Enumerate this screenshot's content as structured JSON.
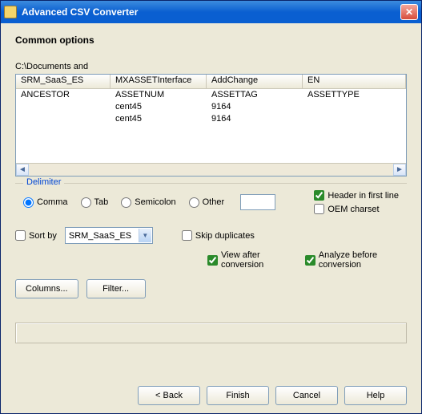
{
  "window": {
    "title": "Advanced CSV Converter"
  },
  "heading": "Common options",
  "path": "C:\\Documents and",
  "columns": [
    "SRM_SaaS_ES",
    "MXASSETInterface",
    "AddChange",
    "EN"
  ],
  "rows": [
    [
      "ANCESTOR",
      "ASSETNUM",
      "ASSETTAG",
      "ASSETTYPE"
    ],
    [
      "",
      "cent45",
      "9164",
      ""
    ],
    [
      "",
      "cent45",
      "9164",
      ""
    ]
  ],
  "delimiter": {
    "label": "Delimiter",
    "options": {
      "comma": "Comma",
      "tab": "Tab",
      "semicolon": "Semicolon",
      "other": "Other"
    },
    "selected": "comma",
    "other_value": ""
  },
  "checks": {
    "header_first_line": {
      "label": "Header in first line",
      "checked": true
    },
    "oem_charset": {
      "label": "OEM charset",
      "checked": false
    },
    "sort_by": {
      "label": "Sort by",
      "checked": false
    },
    "skip_duplicates": {
      "label": "Skip duplicates",
      "checked": false
    },
    "view_after": {
      "label": "View after conversion",
      "checked": true
    },
    "analyze_before": {
      "label": "Analyze before conversion",
      "checked": true
    }
  },
  "sort_field": "SRM_SaaS_ES",
  "buttons": {
    "columns": "Columns...",
    "filter": "Filter...",
    "back": "< Back",
    "finish": "Finish",
    "cancel": "Cancel",
    "help": "Help"
  }
}
